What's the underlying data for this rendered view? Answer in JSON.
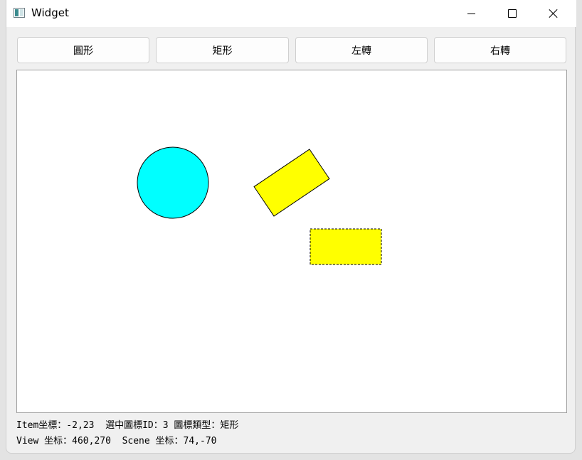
{
  "window": {
    "title": "Widget",
    "icon": "app-window-icon",
    "controls": [
      "minimize-icon",
      "maximize-icon",
      "close-icon"
    ]
  },
  "toolbar": {
    "circle_label": "圓形",
    "rect_label": "矩形",
    "rotate_left_label": "左轉",
    "rotate_right_label": "右轉"
  },
  "scene": {
    "background": "#ffffff",
    "items": [
      {
        "kind": "ellipse",
        "fill": "#00ffff",
        "stroke": "#000000"
      },
      {
        "kind": "rect",
        "rotation_deg": -34,
        "fill": "#ffff00",
        "stroke": "#000000"
      },
      {
        "kind": "rect",
        "fill": "#ffff00",
        "stroke": "#000000",
        "selected": true
      }
    ]
  },
  "status": {
    "line1": "Item坐標：-2,23  選中圖標ID：3 圖標類型：矩形",
    "line2": "View 坐标：460,270  Scene 坐标：74,-70"
  }
}
